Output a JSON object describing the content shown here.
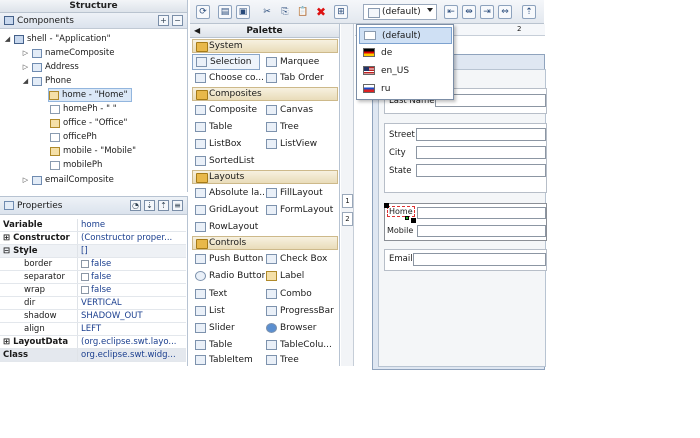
{
  "structure": {
    "title": "Structure",
    "subheader": "Components",
    "tree": [
      {
        "label": "shell - \"Application\"",
        "depth": 0,
        "expanded": true,
        "icon": "shell"
      },
      {
        "label": "nameComposite",
        "depth": 1,
        "expanded": false,
        "icon": "composite"
      },
      {
        "label": "Address",
        "depth": 1,
        "expanded": false,
        "icon": "composite"
      },
      {
        "label": "Phone",
        "depth": 1,
        "expanded": true,
        "icon": "composite"
      },
      {
        "label": "home - \"Home\"",
        "depth": 2,
        "icon": "label",
        "selected": true
      },
      {
        "label": "homePh - \" \"",
        "depth": 2,
        "icon": "text"
      },
      {
        "label": "office - \"Office\"",
        "depth": 2,
        "icon": "label"
      },
      {
        "label": "officePh",
        "depth": 2,
        "icon": "text"
      },
      {
        "label": "mobile - \"Mobile\"",
        "depth": 2,
        "icon": "label"
      },
      {
        "label": "mobilePh",
        "depth": 2,
        "icon": "text"
      },
      {
        "label": "emailComposite",
        "depth": 1,
        "expanded": false,
        "icon": "composite"
      }
    ]
  },
  "properties": {
    "title": "Properties",
    "rows": [
      {
        "key": "Variable",
        "value": "home",
        "bold": true
      },
      {
        "key": "Constructor",
        "value": "(Constructor proper...",
        "bold": true,
        "expandable": true
      },
      {
        "key": "Style",
        "value": "[]",
        "bold": true,
        "expandable": true,
        "expanded": true
      },
      {
        "key": "border",
        "value": "false",
        "checkbox": true
      },
      {
        "key": "separator",
        "value": "false",
        "checkbox": true
      },
      {
        "key": "wrap",
        "value": "false",
        "checkbox": true
      },
      {
        "key": "dir",
        "value": "VERTICAL"
      },
      {
        "key": "shadow",
        "value": "SHADOW_OUT"
      },
      {
        "key": "align",
        "value": "LEFT"
      },
      {
        "key": "LayoutData",
        "value": "(org.eclipse.swt.layo...",
        "bold": true,
        "expandable": true
      },
      {
        "key": "Class",
        "value": "org.eclipse.swt.widg...",
        "bold": true,
        "class_row": true
      }
    ]
  },
  "toolbar": {
    "locale_value": "(default)"
  },
  "palette": {
    "title": "Palette",
    "categories": [
      {
        "name": "System",
        "items": [
          "Selection",
          "Marquee",
          "Choose co...",
          "Tab Order"
        ]
      },
      {
        "name": "Composites",
        "items": [
          "Composite",
          "Canvas",
          "Table",
          "Tree",
          "ListBox",
          "ListView",
          "SortedList"
        ]
      },
      {
        "name": "Layouts",
        "items": [
          "Absolute la...",
          "FillLayout",
          "GridLayout",
          "FormLayout",
          "RowLayout"
        ]
      },
      {
        "name": "Controls",
        "items": [
          "Push Button",
          "Check Box",
          "Radio Button",
          "Label",
          "Text",
          "Combo",
          "List",
          "ProgressBar",
          "Slider",
          "Browser",
          "Table",
          "TableColu...",
          "TableItem",
          "Tree"
        ]
      }
    ]
  },
  "ruler": {
    "numbers": [
      "1",
      "2"
    ],
    "top_number": "2"
  },
  "form": {
    "labels": {
      "last_name": "Last Name",
      "street": "Street",
      "city": "City",
      "state": "State",
      "home": "Home",
      "mobile": "Mobile",
      "email": "Email"
    }
  },
  "locale_menu": {
    "items": [
      {
        "label": "(default)",
        "flag": "none",
        "highlighted": true
      },
      {
        "label": "de",
        "flag": "de"
      },
      {
        "label": "en_US",
        "flag": "us"
      },
      {
        "label": "ru",
        "flag": "ru"
      }
    ]
  }
}
